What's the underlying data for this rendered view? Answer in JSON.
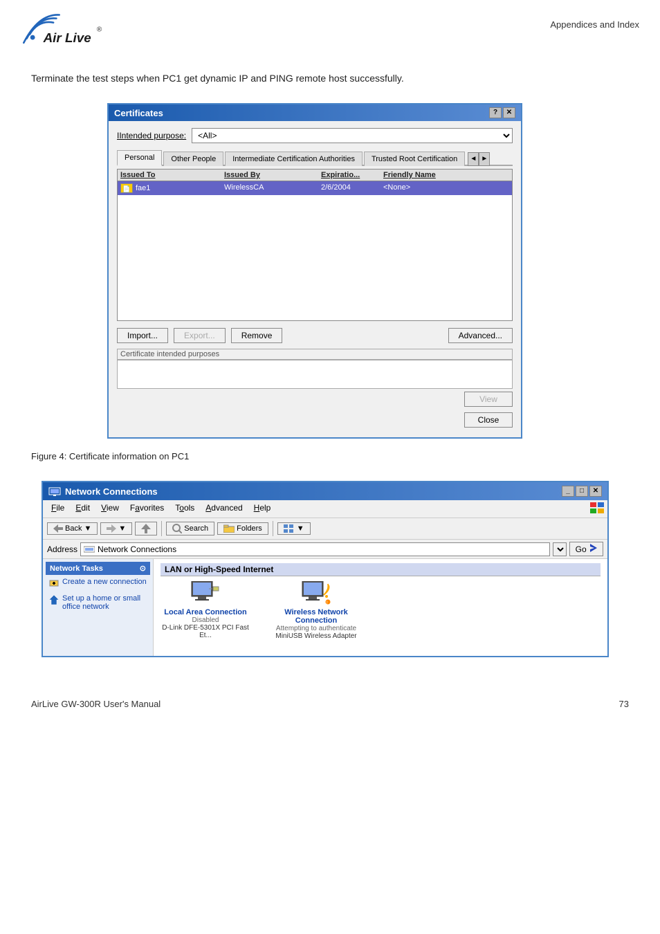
{
  "header": {
    "appendices_title": "Appendices and Index"
  },
  "intro": {
    "text": "Terminate the test steps when PC1 get dynamic IP and PING remote host successfully."
  },
  "certificates_dialog": {
    "title": "Certificates",
    "intended_purpose_label": "Intended purpose:",
    "intended_purpose_value": "<All>",
    "tabs": [
      {
        "label": "Personal",
        "active": true
      },
      {
        "label": "Other People",
        "active": false
      },
      {
        "label": "Intermediate Certification Authorities",
        "active": false
      },
      {
        "label": "Trusted Root Certification",
        "active": false
      }
    ],
    "table": {
      "columns": [
        "Issued To",
        "Issued By",
        "Expiratio...",
        "Friendly Name"
      ],
      "rows": [
        {
          "issued_to": "fae1",
          "issued_by": "WirelessCA",
          "expiration": "2/6/2004",
          "friendly_name": "<None>"
        }
      ]
    },
    "buttons": {
      "import": "Import...",
      "export": "Export...",
      "remove": "Remove",
      "advanced": "Advanced...",
      "view": "View",
      "close": "Close"
    },
    "cert_intended_purposes_label": "Certificate intended purposes"
  },
  "figure_caption": "Figure 4: Certificate information on PC1",
  "network_connections_dialog": {
    "title": "Network Connections",
    "menubar": [
      {
        "label": "File"
      },
      {
        "label": "Edit"
      },
      {
        "label": "View"
      },
      {
        "label": "Favorites"
      },
      {
        "label": "Tools"
      },
      {
        "label": "Advanced"
      },
      {
        "label": "Help"
      }
    ],
    "toolbar": {
      "back": "Back",
      "forward": "",
      "search": "Search",
      "folders": "Folders",
      "views": ""
    },
    "address": {
      "label": "Address",
      "value": "Network Connections",
      "go": "Go"
    },
    "section_title": "LAN or High-Speed Internet",
    "sidebar": {
      "section": "Network Tasks",
      "items": [
        {
          "label": "Create a new connection"
        },
        {
          "label": "Set up a home or small office network"
        }
      ]
    },
    "connections": [
      {
        "name": "Local Area Connection",
        "status": "Disabled",
        "device": "D-Link DFE-5301X PCI Fast Et...",
        "type": "lan"
      },
      {
        "name": "Wireless Network Connection",
        "status": "Attempting to authenticate",
        "device": "MiniUSB Wireless Adapter",
        "type": "wireless"
      }
    ]
  },
  "footer": {
    "product": "AirLive GW-300R User's Manual",
    "page": "73"
  }
}
